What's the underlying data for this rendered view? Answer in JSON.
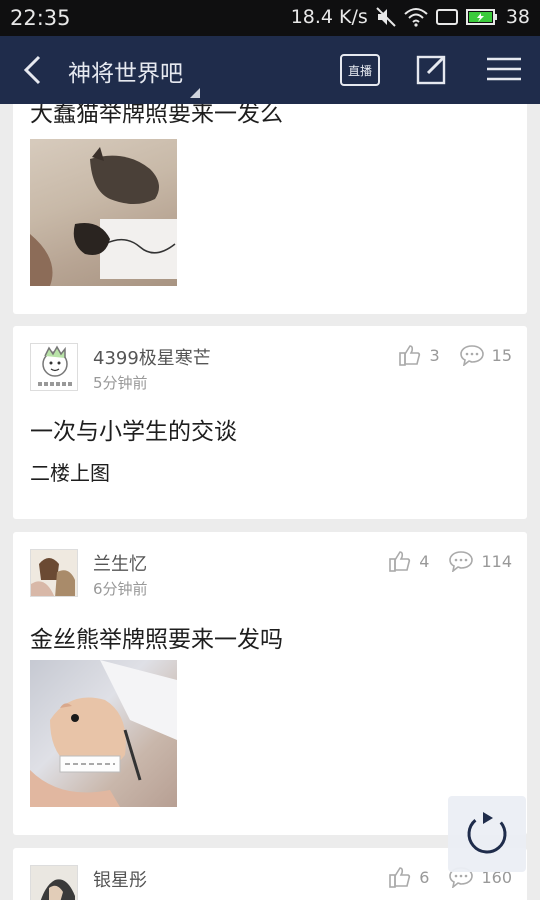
{
  "status_bar": {
    "time": "22:35",
    "network_speed": "18.4 K/s",
    "battery": "38"
  },
  "app_bar": {
    "title": "神将世界吧",
    "live_label": "直播",
    "back_icon": "back-arrow-icon",
    "edit_icon": "edit-icon",
    "menu_icon": "menu-icon"
  },
  "colors": {
    "status_bg": "#0f0f10",
    "app_bar_bg": "#1f2c4b",
    "feed_bg": "#ececec",
    "refresh_icon": "#1f2c4b",
    "battery_fill": "#3ccb3c"
  },
  "posts": [
    {
      "title": "大蠢猫举牌照要来一发么",
      "image": "photo-cat-sign"
    },
    {
      "author": "4399极星寒芒",
      "time": "5分钟前",
      "likes": "3",
      "comments": "15",
      "title": "一次与小学生的交谈",
      "body": "二楼上图"
    },
    {
      "author": "兰生忆",
      "time": "6分钟前",
      "likes": "4",
      "comments": "114",
      "title": "金丝熊举牌照要来一发吗",
      "image": "photo-hamster-sign"
    },
    {
      "author": "银星彤",
      "time": "",
      "likes": "6",
      "comments": "160"
    }
  ]
}
